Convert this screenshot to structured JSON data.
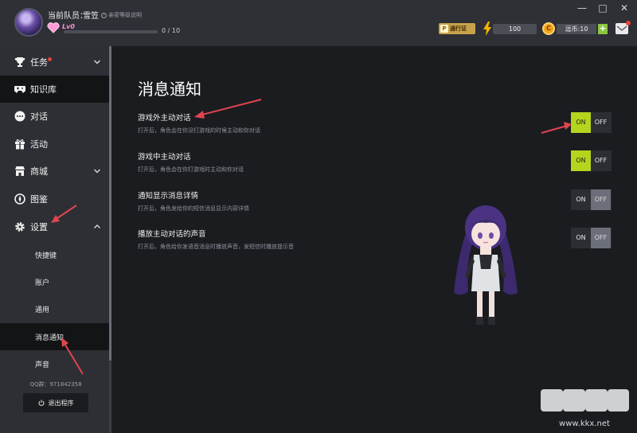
{
  "window": {
    "minimize": "—",
    "maximize": "□",
    "close": "✕"
  },
  "profile": {
    "team_label": "当前队员：",
    "team_name": "雪笠",
    "help_text": "亲密等级说明",
    "level": "Lv0",
    "xp_text": "0 / 10",
    "xp_progress": 0.0
  },
  "resources": {
    "pass_label": "通行证",
    "energy": "100",
    "coins": "逗币:10",
    "coin_symbol": "C",
    "pass_symbol": "P"
  },
  "sidebar": {
    "items": [
      {
        "label": "任务",
        "icon": "trophy-icon",
        "badge": true,
        "chevron": "down"
      },
      {
        "label": "知识库",
        "icon": "gamepad-icon",
        "active": true
      },
      {
        "label": "对话",
        "icon": "chat-bubble-icon"
      },
      {
        "label": "活动",
        "icon": "gift-icon"
      },
      {
        "label": "商城",
        "icon": "shop-icon",
        "chevron": "down"
      },
      {
        "label": "图鉴",
        "icon": "compass-icon"
      },
      {
        "label": "设置",
        "icon": "gear-icon",
        "chevron": "up"
      }
    ],
    "sub_items": [
      {
        "label": "快捷键"
      },
      {
        "label": "账户"
      },
      {
        "label": "通用"
      },
      {
        "label": "消息通知",
        "active": true
      },
      {
        "label": "声音"
      }
    ],
    "qq": "QQ群：971842358",
    "logout": "退出程序"
  },
  "main": {
    "title": "消息通知",
    "settings": [
      {
        "title": "游戏外主动对话",
        "desc": "打开后，角色会在你没打游戏的时候主动和你对话",
        "on": "ON",
        "off": "OFF",
        "state": "on"
      },
      {
        "title": "游戏中主动对话",
        "desc": "打开后，角色会在你打游戏时主动和你对话",
        "on": "ON",
        "off": "OFF",
        "state": "on"
      },
      {
        "title": "通知显示消息详情",
        "desc": "打开后，角色发给你的短信消息显示内容详情",
        "on": "ON",
        "off": "OFF",
        "state": "off"
      },
      {
        "title": "播放主动对话的声音",
        "desc": "打开后，角色给你发语音消息时播放声音，发短信时播放提示音",
        "on": "ON",
        "off": "OFF",
        "state": "off"
      }
    ]
  },
  "watermark": "www.kkx.net",
  "colors": {
    "accent_on": "#b3d51e",
    "off_active": "#6c6f79",
    "annotation_arrow": "#e0454f",
    "sidebar_bg": "#2d2f34",
    "main_bg": "#1b1c20"
  }
}
